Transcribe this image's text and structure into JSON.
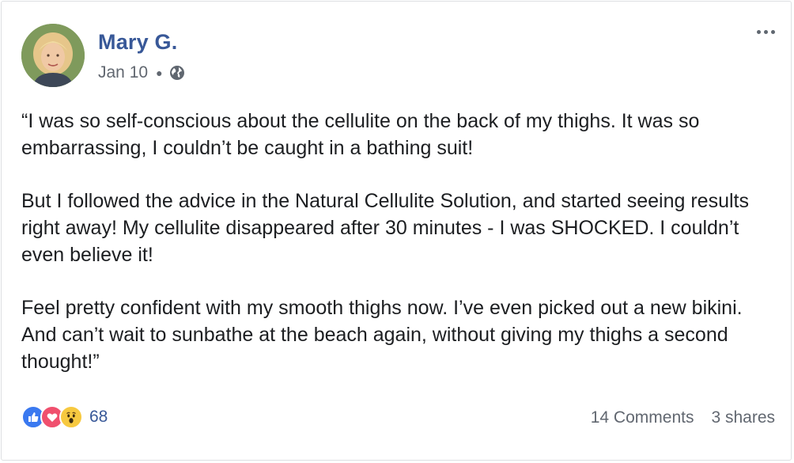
{
  "post": {
    "author": "Mary G.",
    "date": "Jan 10",
    "privacy_icon": "globe-icon",
    "paragraphs": [
      "“I was so self-conscious about the cellulite on the back of my thighs. It was so embarrassing, I couldn’t be caught in a bathing suit!",
      "But I followed the advice in the Natural Cellulite Solution, and started seeing results right away! My cellulite disappeared after 30 minutes - I was SHOCKED. I couldn’t even believe it!",
      "Feel pretty confident with my smooth thighs now. I’ve even picked out a new bikini. And can’t wait to sunbathe at the beach again, without giving my thighs a second thought!”"
    ]
  },
  "footer": {
    "reactions": [
      "like-icon",
      "love-icon",
      "wow-icon"
    ],
    "reaction_count": "68",
    "comments": "14 Comments",
    "shares": "3 shares"
  },
  "colors": {
    "author": "#385898",
    "text": "#1c1e21",
    "muted": "#616770",
    "like": "#3a79f0",
    "love": "#f0506e",
    "wow": "#f7c940"
  }
}
